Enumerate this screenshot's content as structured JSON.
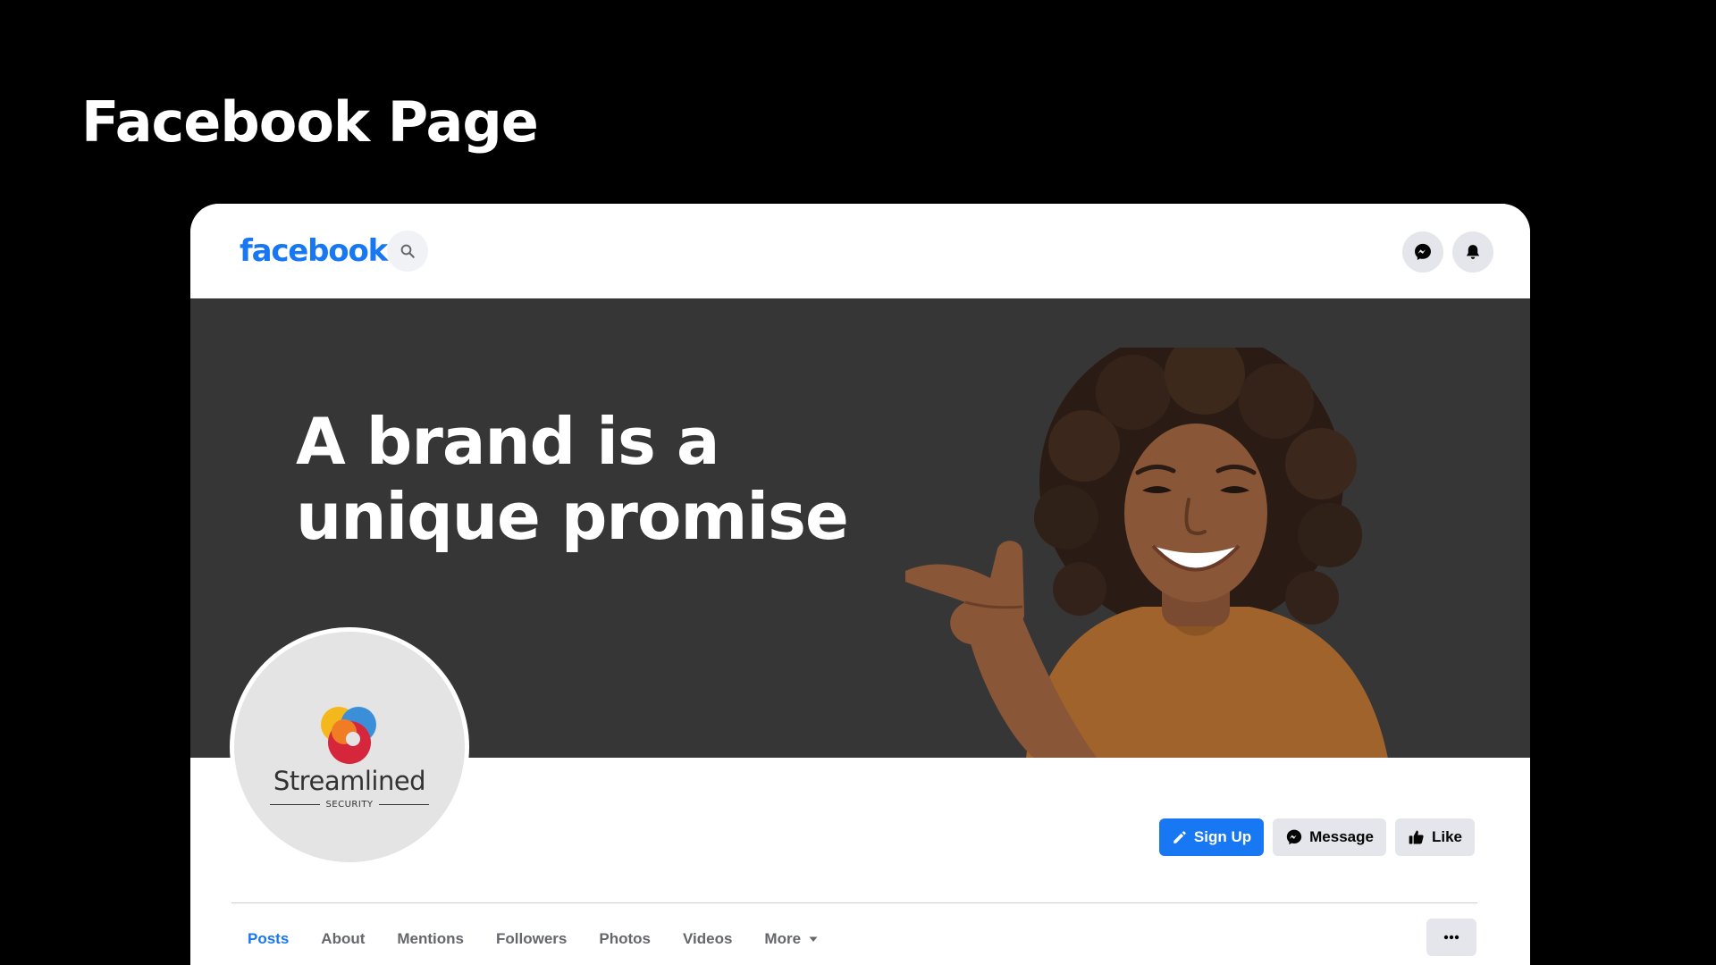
{
  "slide": {
    "title": "Facebook Page"
  },
  "header": {
    "logo_text": "facebook",
    "search_icon": "search-icon",
    "messenger_icon": "messenger-icon",
    "notifications_icon": "bell-icon"
  },
  "cover": {
    "headline_line1": "A brand is a",
    "headline_line2": "unique promise",
    "background_color": "#363636"
  },
  "profile": {
    "brand_name": "Streamlined",
    "brand_tagline": "SECURITY"
  },
  "actions": {
    "sign_up_label": "Sign Up",
    "message_label": "Message",
    "like_label": "Like"
  },
  "tabs": [
    {
      "label": "Posts",
      "active": true
    },
    {
      "label": "About",
      "active": false
    },
    {
      "label": "Mentions",
      "active": false
    },
    {
      "label": "Followers",
      "active": false
    },
    {
      "label": "Photos",
      "active": false
    },
    {
      "label": "Videos",
      "active": false
    },
    {
      "label": "More",
      "active": false
    }
  ],
  "colors": {
    "facebook_blue": "#1877f2",
    "button_gray": "#e4e6eb",
    "tab_gray": "#65676b"
  }
}
